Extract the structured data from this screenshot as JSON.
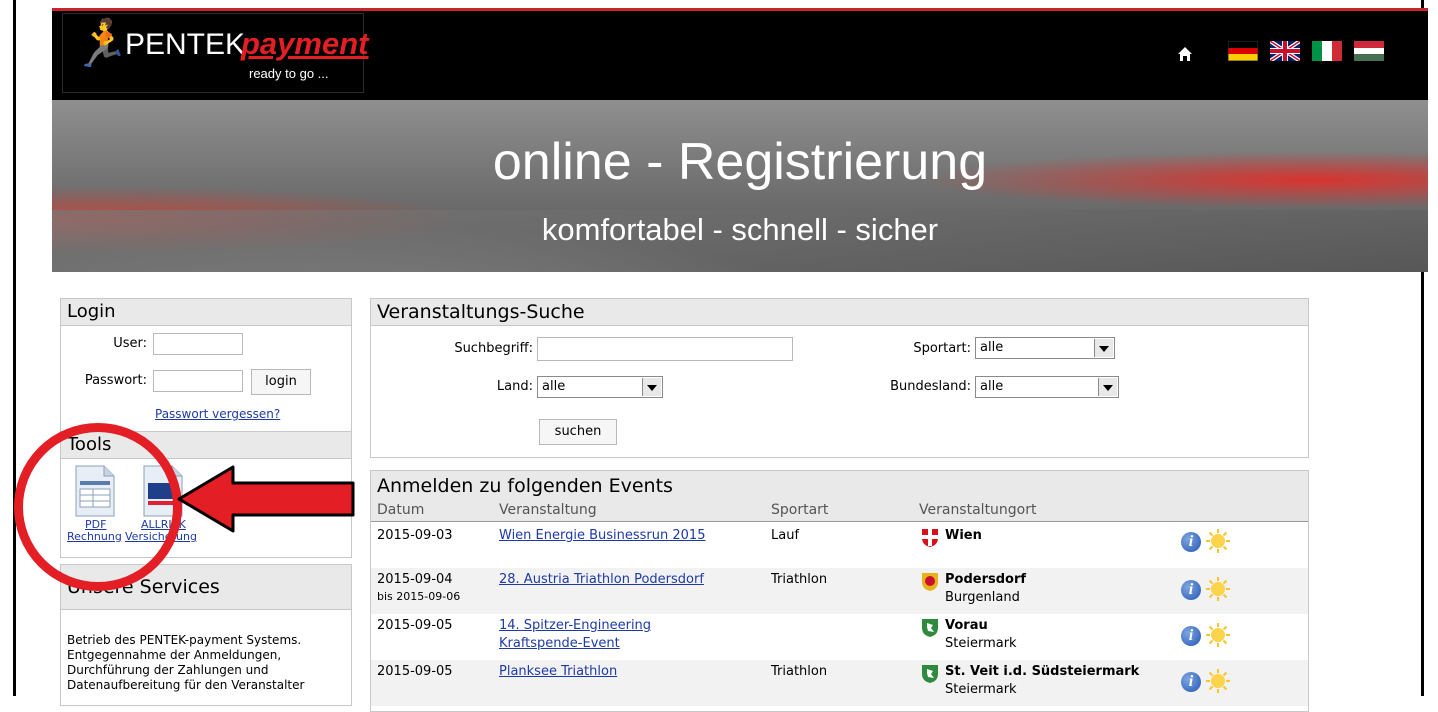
{
  "header": {
    "logo_brand_1": "PENTEK",
    "logo_brand_2": "payment",
    "logo_tagline": "ready to go ...",
    "flags": [
      "flag-de-icon",
      "flag-uk-icon",
      "flag-it-icon",
      "flag-hu-icon"
    ]
  },
  "banner": {
    "title": "online - Registrierung",
    "subtitle": "komfortabel - schnell - sicher"
  },
  "login": {
    "heading": "Login",
    "user_label": "User:",
    "user_value": "",
    "password_label": "Passwort:",
    "password_value": "",
    "login_button": "login",
    "forgot_link": "Passwort vergessen?"
  },
  "tools": {
    "heading": "Tools",
    "pdf_label_1": "PDF",
    "pdf_label_2": "Rechnung",
    "allrisk_label_1": "ALLRISK",
    "allrisk_label_2": "Versicherung"
  },
  "services": {
    "heading": "Unsere Services",
    "text_1": "Betrieb des PENTEK-payment Systems.",
    "text_2": "Entgegennahme der Anmeldungen,",
    "text_3": "Durchführung der Zahlungen und",
    "text_4": "Datenaufbereitung für den Veranstalter"
  },
  "search": {
    "heading": "Veranstaltungs-Suche",
    "term_label": "Suchbegriff:",
    "term_value": "",
    "sport_label": "Sportart:",
    "sport_value": "alle",
    "country_label": "Land:",
    "country_value": "alle",
    "state_label": "Bundesland:",
    "state_value": "alle",
    "search_button": "suchen"
  },
  "events": {
    "heading": "Anmelden zu folgenden Events",
    "columns": [
      "Datum",
      "Veranstaltung",
      "Sportart",
      "Veranstaltungort"
    ],
    "rows": [
      {
        "date": "2015-09-03",
        "date_to": "",
        "name_1": "Wien Energie Businessrun 2015",
        "name_2": "",
        "sport": "Lauf",
        "place": "Wien",
        "region": ""
      },
      {
        "date": "2015-09-04",
        "date_to": "bis 2015-09-06",
        "name_1": "28. Austria Triathlon Podersdorf",
        "name_2": "",
        "sport": "Triathlon",
        "place": "Podersdorf",
        "region": "Burgenland"
      },
      {
        "date": "2015-09-05",
        "date_to": "",
        "name_1": "14. Spitzer-Engineering",
        "name_2": "Kraftspende-Event",
        "sport": "",
        "place": "Vorau",
        "region": "Steiermark"
      },
      {
        "date": "2015-09-05",
        "date_to": "",
        "name_1": "Planksee Triathlon",
        "name_2": "",
        "sport": "Triathlon",
        "place": "St. Veit i.d. Südsteiermark",
        "region": "Steiermark"
      }
    ]
  }
}
